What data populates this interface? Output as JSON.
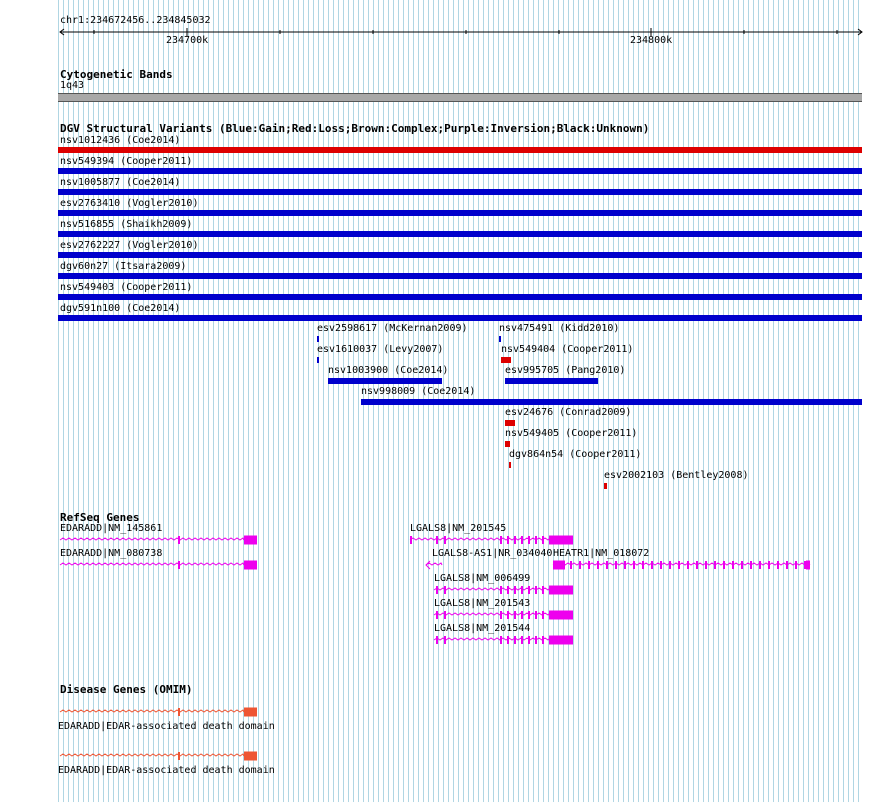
{
  "ruler": {
    "position": "chr1:234672456..234845032",
    "ticks": [
      "234700k",
      "234800k"
    ]
  },
  "cytobands": {
    "title": "Cytogenetic Bands",
    "band": "1q43"
  },
  "dgv": {
    "title": "DGV Structural Variants (Blue:Gain;Red:Loss;Brown:Complex;Purple:Inversion;Black:Unknown)",
    "full_span": [
      {
        "label": "nsv1012436 (Coe2014)",
        "color": "#dd0000"
      },
      {
        "label": "nsv549394 (Cooper2011)",
        "color": "#0000cc"
      },
      {
        "label": "nsv1005877 (Coe2014)",
        "color": "#0000cc"
      },
      {
        "label": "esv2763410 (Vogler2010)",
        "color": "#0000cc"
      },
      {
        "label": "nsv516855 (Shaikh2009)",
        "color": "#0000cc"
      },
      {
        "label": "esv2762227 (Vogler2010)",
        "color": "#0000cc"
      },
      {
        "label": "dgv60n27 (Itsara2009)",
        "color": "#0000cc"
      },
      {
        "label": "nsv549403 (Cooper2011)",
        "color": "#0000cc"
      },
      {
        "label": "dgv591n100 (Coe2014)",
        "color": "#0000cc"
      }
    ],
    "partial": [
      {
        "label": "esv2598617 (McKernan2009)",
        "color": "#0000cc"
      },
      {
        "label": "nsv475491 (Kidd2010)",
        "color": "#0000cc"
      },
      {
        "label": "esv1610037 (Levy2007)",
        "color": "#0000cc"
      },
      {
        "label": "nsv549404 (Cooper2011)",
        "color": "#dd0000"
      },
      {
        "label": "nsv1003900 (Coe2014)",
        "color": "#0000cc"
      },
      {
        "label": "esv995705 (Pang2010)",
        "color": "#0000cc"
      },
      {
        "label": "nsv998009 (Coe2014)",
        "color": "#0000cc"
      },
      {
        "label": "esv24676 (Conrad2009)",
        "color": "#dd0000"
      },
      {
        "label": "nsv549405 (Cooper2011)",
        "color": "#dd0000"
      },
      {
        "label": "dgv864n54 (Cooper2011)",
        "color": "#dd0000"
      },
      {
        "label": "esv2002103 (Bentley2008)",
        "color": "#dd0000"
      }
    ]
  },
  "refseq": {
    "title": "RefSeq Genes",
    "color": "#ee00ee",
    "genes": [
      {
        "label": "EDARADD|NM_145861"
      },
      {
        "label": "EDARADD|NM_080738"
      },
      {
        "label": "LGALS8|NM_201545"
      },
      {
        "label": "LGALS8-AS1|NR_034040"
      },
      {
        "label": "HEATR1|NM_018072"
      },
      {
        "label": "LGALS8|NM_006499"
      },
      {
        "label": "LGALS8|NM_201543"
      },
      {
        "label": "LGALS8|NM_201544"
      }
    ]
  },
  "omim": {
    "title": "Disease Genes (OMIM)",
    "color": "#ee5533",
    "genes": [
      {
        "label": "EDARADD|EDAR-associated death domain"
      },
      {
        "label": "EDARADD|EDAR-associated death domain"
      }
    ]
  }
}
